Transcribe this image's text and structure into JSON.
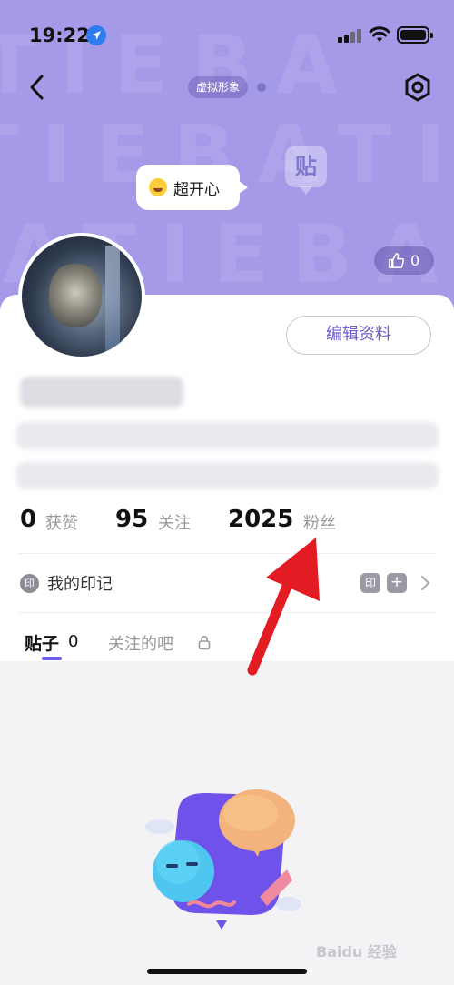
{
  "status_bar": {
    "time": "19:22"
  },
  "header": {
    "avatar_chip": "虚拟形象"
  },
  "hero": {
    "watermark_row_1": "TIEBA",
    "watermark_row_2": "TIEBATIEBA",
    "watermark_row_3": "BATIEBA",
    "mood": "超开心",
    "tieba_logo": "贴",
    "likes": "0"
  },
  "profile": {
    "edit_button": "编辑资料",
    "mark_icon": "印"
  },
  "stats": [
    {
      "value": "0",
      "label": "获赞"
    },
    {
      "value": "95",
      "label": "关注"
    },
    {
      "value": "2025",
      "label": "粉丝"
    }
  ],
  "marks": {
    "label": "我的印记",
    "badge_1": "印",
    "badge_2": "+"
  },
  "tabs": {
    "posts_label": "贴子",
    "posts_count": "0",
    "followed_bars": "关注的吧"
  },
  "watermark": {
    "text": "Baidu 经验"
  },
  "colors": {
    "hero_bg": "#a59ae8",
    "accent": "#6c5ce7",
    "annotation_arrow": "#e31b23"
  }
}
